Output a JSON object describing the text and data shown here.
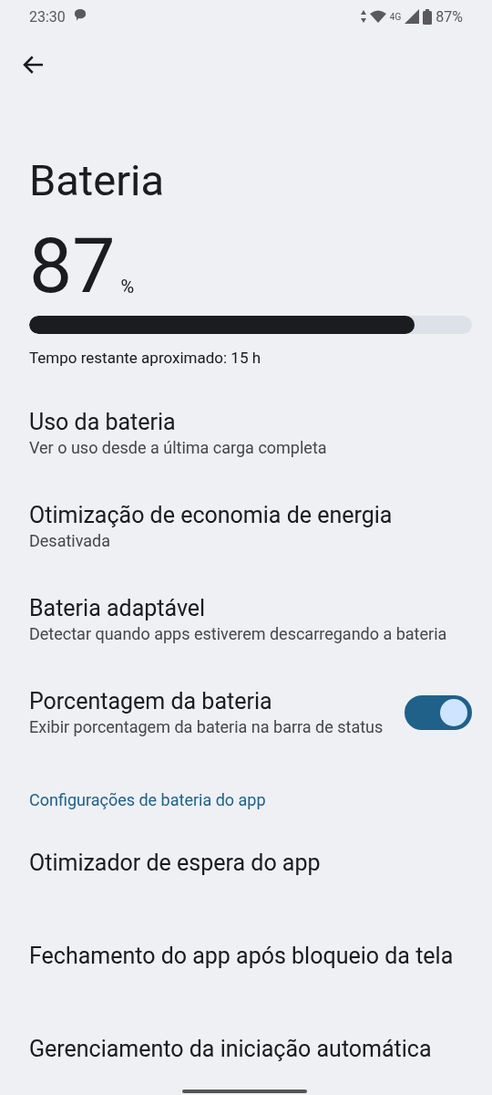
{
  "status_bar": {
    "time": "23:30",
    "network": "4G",
    "battery": "87%"
  },
  "title": "Bateria",
  "battery": {
    "percent": "87",
    "unit": "%",
    "level": 0.87,
    "remaining": "Tempo restante aproximado: 15 h"
  },
  "items": [
    {
      "kind": "text",
      "title": "Uso da bateria",
      "subtitle": "Ver o uso desde a última carga completa"
    },
    {
      "kind": "text",
      "title": "Otimização de economia de energia",
      "subtitle": "Desativada"
    },
    {
      "kind": "text",
      "title": "Bateria adaptável",
      "subtitle": "Detectar quando apps estiverem descarregando a bateria"
    },
    {
      "kind": "switch",
      "title": "Porcentagem da bateria",
      "subtitle": "Exibir porcentagem da bateria na barra de status",
      "on": true
    },
    {
      "kind": "header",
      "title": "Configurações de bateria do app"
    },
    {
      "kind": "text",
      "title": "Otimizador de espera do app"
    },
    {
      "kind": "text",
      "title": "Fechamento do app após bloqueio da tela"
    },
    {
      "kind": "text",
      "title": "Gerenciamento da iniciação automática"
    }
  ]
}
